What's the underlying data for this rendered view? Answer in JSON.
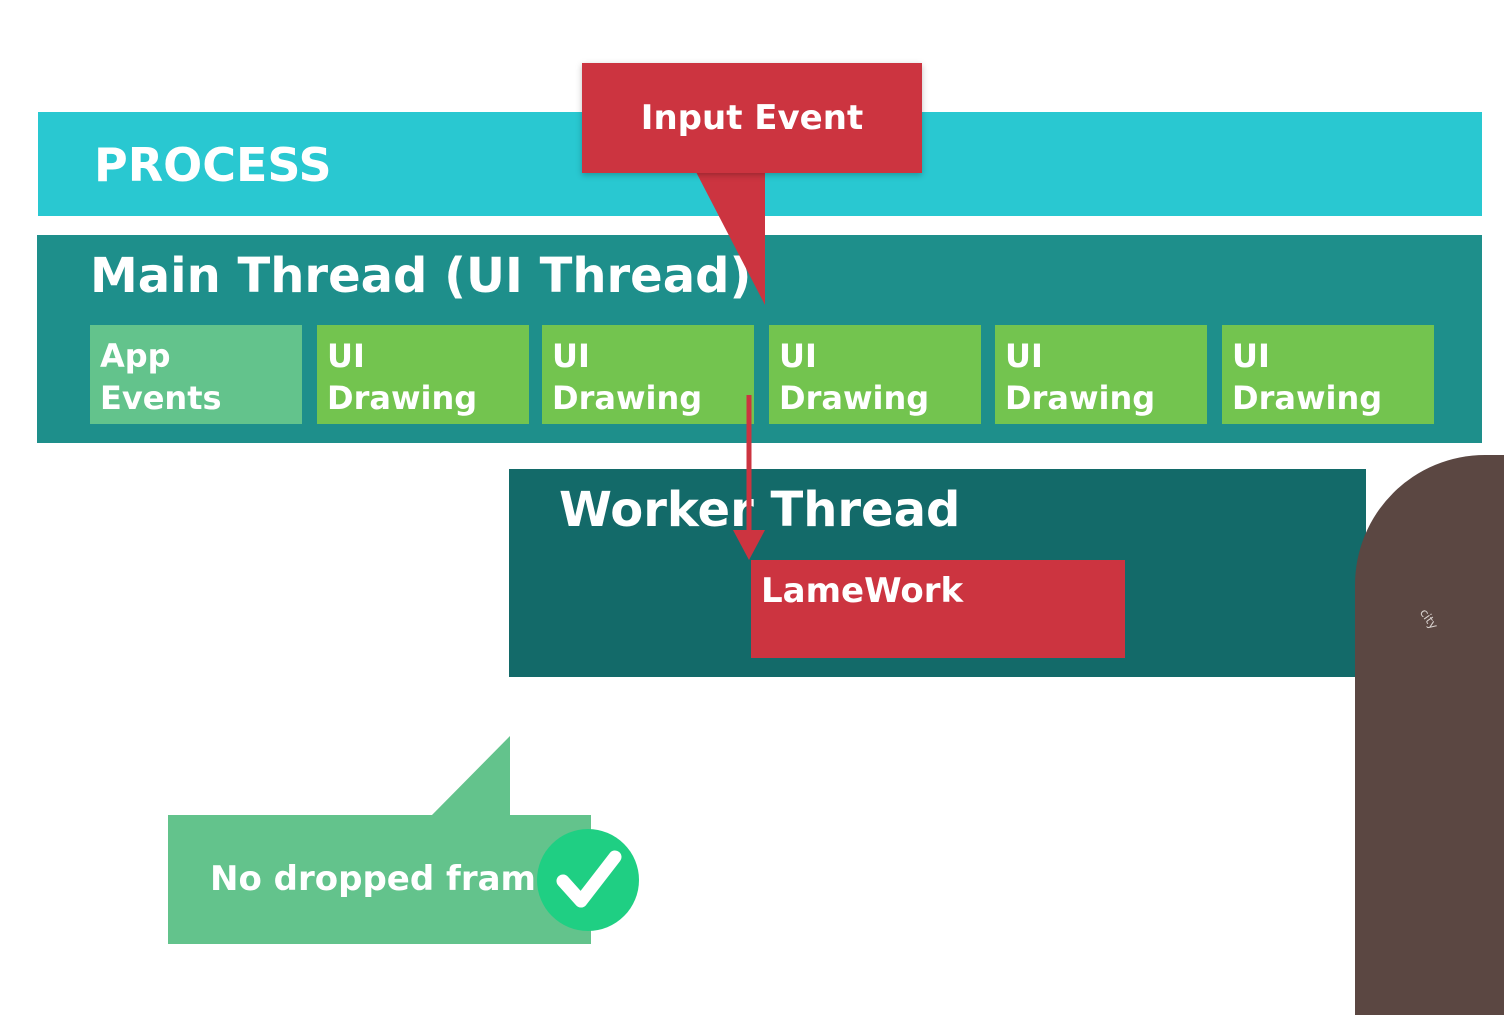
{
  "process": {
    "label": "PROCESS"
  },
  "main_thread": {
    "title": "Main Thread (UI Thread)",
    "blocks": [
      {
        "line1": "App",
        "line2": "Events"
      },
      {
        "line1": "UI",
        "line2": "Drawing"
      },
      {
        "line1": "UI",
        "line2": "Drawing"
      },
      {
        "line1": "UI",
        "line2": "Drawing"
      },
      {
        "line1": "UI",
        "line2": "Drawing"
      },
      {
        "line1": "UI",
        "line2": "Drawing"
      }
    ]
  },
  "input_event": {
    "label": "Input Event"
  },
  "worker_thread": {
    "title": "Worker Thread",
    "task": "LameWork"
  },
  "callout": {
    "text": "No dropped frames!"
  },
  "presenter": {
    "shirt_text": "city"
  },
  "colors": {
    "process": "#29c8d1",
    "main_thread": "#1e8f8b",
    "worker_thread": "#136a69",
    "app_events": "#63c38c",
    "ui_drawing": "#73c44f",
    "red": "#cc3440",
    "callout": "#63c38c",
    "check": "#1fcf83"
  }
}
